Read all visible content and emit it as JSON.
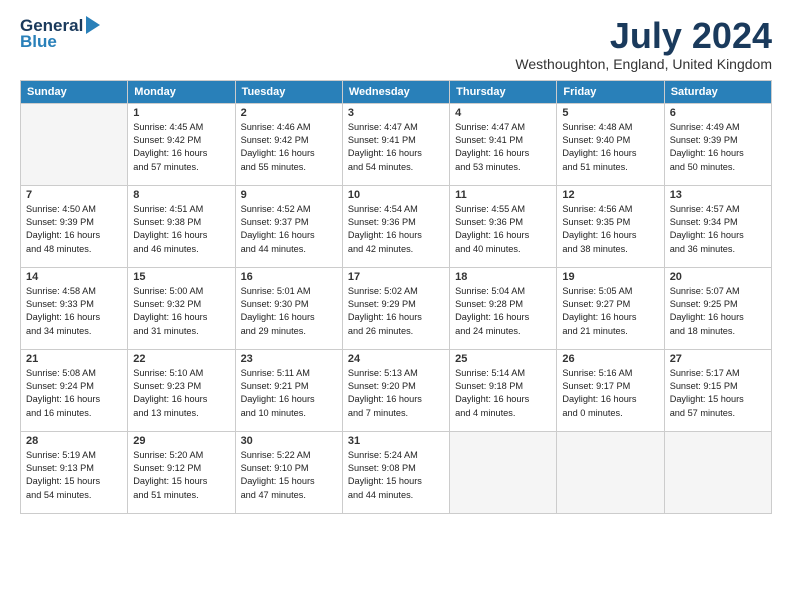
{
  "header": {
    "logo_general": "General",
    "logo_blue": "Blue",
    "month_title": "July 2024",
    "subtitle": "Westhoughton, England, United Kingdom"
  },
  "weekdays": [
    "Sunday",
    "Monday",
    "Tuesday",
    "Wednesday",
    "Thursday",
    "Friday",
    "Saturday"
  ],
  "weeks": [
    [
      {
        "day": "",
        "info": ""
      },
      {
        "day": "1",
        "info": "Sunrise: 4:45 AM\nSunset: 9:42 PM\nDaylight: 16 hours\nand 57 minutes."
      },
      {
        "day": "2",
        "info": "Sunrise: 4:46 AM\nSunset: 9:42 PM\nDaylight: 16 hours\nand 55 minutes."
      },
      {
        "day": "3",
        "info": "Sunrise: 4:47 AM\nSunset: 9:41 PM\nDaylight: 16 hours\nand 54 minutes."
      },
      {
        "day": "4",
        "info": "Sunrise: 4:47 AM\nSunset: 9:41 PM\nDaylight: 16 hours\nand 53 minutes."
      },
      {
        "day": "5",
        "info": "Sunrise: 4:48 AM\nSunset: 9:40 PM\nDaylight: 16 hours\nand 51 minutes."
      },
      {
        "day": "6",
        "info": "Sunrise: 4:49 AM\nSunset: 9:39 PM\nDaylight: 16 hours\nand 50 minutes."
      }
    ],
    [
      {
        "day": "7",
        "info": "Sunrise: 4:50 AM\nSunset: 9:39 PM\nDaylight: 16 hours\nand 48 minutes."
      },
      {
        "day": "8",
        "info": "Sunrise: 4:51 AM\nSunset: 9:38 PM\nDaylight: 16 hours\nand 46 minutes."
      },
      {
        "day": "9",
        "info": "Sunrise: 4:52 AM\nSunset: 9:37 PM\nDaylight: 16 hours\nand 44 minutes."
      },
      {
        "day": "10",
        "info": "Sunrise: 4:54 AM\nSunset: 9:36 PM\nDaylight: 16 hours\nand 42 minutes."
      },
      {
        "day": "11",
        "info": "Sunrise: 4:55 AM\nSunset: 9:36 PM\nDaylight: 16 hours\nand 40 minutes."
      },
      {
        "day": "12",
        "info": "Sunrise: 4:56 AM\nSunset: 9:35 PM\nDaylight: 16 hours\nand 38 minutes."
      },
      {
        "day": "13",
        "info": "Sunrise: 4:57 AM\nSunset: 9:34 PM\nDaylight: 16 hours\nand 36 minutes."
      }
    ],
    [
      {
        "day": "14",
        "info": "Sunrise: 4:58 AM\nSunset: 9:33 PM\nDaylight: 16 hours\nand 34 minutes."
      },
      {
        "day": "15",
        "info": "Sunrise: 5:00 AM\nSunset: 9:32 PM\nDaylight: 16 hours\nand 31 minutes."
      },
      {
        "day": "16",
        "info": "Sunrise: 5:01 AM\nSunset: 9:30 PM\nDaylight: 16 hours\nand 29 minutes."
      },
      {
        "day": "17",
        "info": "Sunrise: 5:02 AM\nSunset: 9:29 PM\nDaylight: 16 hours\nand 26 minutes."
      },
      {
        "day": "18",
        "info": "Sunrise: 5:04 AM\nSunset: 9:28 PM\nDaylight: 16 hours\nand 24 minutes."
      },
      {
        "day": "19",
        "info": "Sunrise: 5:05 AM\nSunset: 9:27 PM\nDaylight: 16 hours\nand 21 minutes."
      },
      {
        "day": "20",
        "info": "Sunrise: 5:07 AM\nSunset: 9:25 PM\nDaylight: 16 hours\nand 18 minutes."
      }
    ],
    [
      {
        "day": "21",
        "info": "Sunrise: 5:08 AM\nSunset: 9:24 PM\nDaylight: 16 hours\nand 16 minutes."
      },
      {
        "day": "22",
        "info": "Sunrise: 5:10 AM\nSunset: 9:23 PM\nDaylight: 16 hours\nand 13 minutes."
      },
      {
        "day": "23",
        "info": "Sunrise: 5:11 AM\nSunset: 9:21 PM\nDaylight: 16 hours\nand 10 minutes."
      },
      {
        "day": "24",
        "info": "Sunrise: 5:13 AM\nSunset: 9:20 PM\nDaylight: 16 hours\nand 7 minutes."
      },
      {
        "day": "25",
        "info": "Sunrise: 5:14 AM\nSunset: 9:18 PM\nDaylight: 16 hours\nand 4 minutes."
      },
      {
        "day": "26",
        "info": "Sunrise: 5:16 AM\nSunset: 9:17 PM\nDaylight: 16 hours\nand 0 minutes."
      },
      {
        "day": "27",
        "info": "Sunrise: 5:17 AM\nSunset: 9:15 PM\nDaylight: 15 hours\nand 57 minutes."
      }
    ],
    [
      {
        "day": "28",
        "info": "Sunrise: 5:19 AM\nSunset: 9:13 PM\nDaylight: 15 hours\nand 54 minutes."
      },
      {
        "day": "29",
        "info": "Sunrise: 5:20 AM\nSunset: 9:12 PM\nDaylight: 15 hours\nand 51 minutes."
      },
      {
        "day": "30",
        "info": "Sunrise: 5:22 AM\nSunset: 9:10 PM\nDaylight: 15 hours\nand 47 minutes."
      },
      {
        "day": "31",
        "info": "Sunrise: 5:24 AM\nSunset: 9:08 PM\nDaylight: 15 hours\nand 44 minutes."
      },
      {
        "day": "",
        "info": ""
      },
      {
        "day": "",
        "info": ""
      },
      {
        "day": "",
        "info": ""
      }
    ]
  ]
}
